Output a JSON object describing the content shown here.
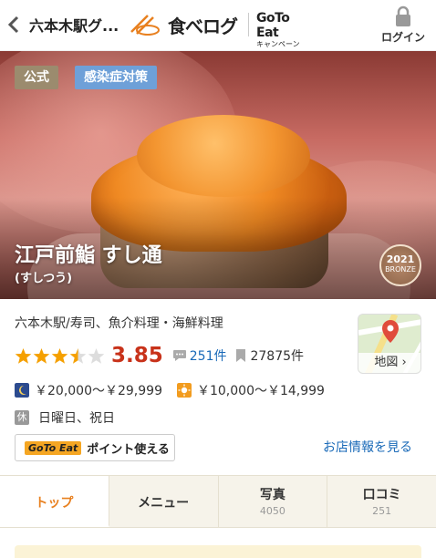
{
  "header": {
    "breadcrumb": "六本木駅グ...",
    "logo_text": "食べログ",
    "gotoeat_top": "GoTo Eat",
    "gotoeat_bottom": "キャンペーン",
    "login_label": "ログイン"
  },
  "hero": {
    "tags": [
      "公式",
      "感染症対策"
    ],
    "name": "江戸前鮨 すし通",
    "kana": "(すしつう)",
    "award_year": "2021",
    "award_rank": "BRONZE"
  },
  "info": {
    "genre": "六本木駅/寿司、魚介料理・海鮮料理",
    "rating_stars": 3.5,
    "score": "3.85",
    "reviews": "251件",
    "bookmarks": "27875件",
    "map_label": "地図 ›",
    "price_dinner": "￥20,000～￥29,999",
    "price_lunch": "￥10,000～￥14,999",
    "holiday_icon": "休",
    "holidays": "日曜日、祝日",
    "gotoeat_badge": "GoTo Eat",
    "gotoeat_points": "ポイント使える",
    "store_info_link": "お店情報を見る"
  },
  "tabs": [
    {
      "label": "トップ",
      "count": ""
    },
    {
      "label": "メニュー",
      "count": ""
    },
    {
      "label": "写真",
      "count": "4050"
    },
    {
      "label": "口コミ",
      "count": "251"
    }
  ],
  "colors": {
    "score": "#c8321a",
    "link": "#1a6ab8",
    "star": "#f5a000",
    "tab_active": "#e8801f"
  }
}
